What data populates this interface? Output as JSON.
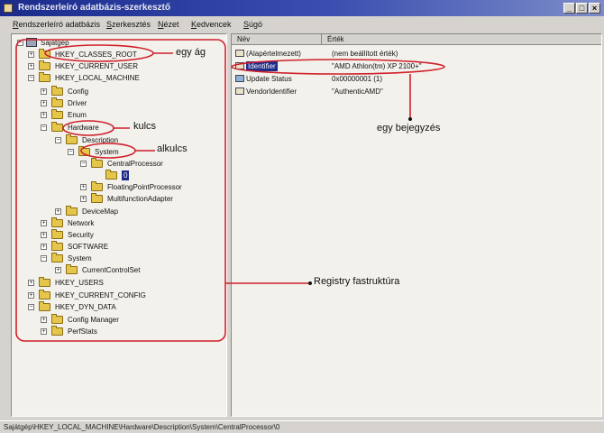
{
  "window": {
    "title": "Rendszerleíró adatbázis-szerkesztő",
    "controls": [
      "_",
      "□",
      "×"
    ]
  },
  "menu": {
    "items": [
      "Rendszerleíró adatbázis",
      "Szerkesztés",
      "Nézet",
      "Kedvencek",
      "Súgó"
    ]
  },
  "tree": {
    "root": "Sajátgép",
    "hkey_classes_root": "HKEY_CLASSES_ROOT",
    "hkey_current_user": "HKEY_CURRENT_USER",
    "hkey_local_machine": "HKEY_LOCAL_MACHINE",
    "config": "Config",
    "driver": "Driver",
    "enum": "Enum",
    "hardware": "Hardware",
    "description": "Description",
    "system_sub": "System",
    "central_processor": "CentralProcessor",
    "zero": "0",
    "floating_point": "FloatingPointProcessor",
    "multifunction": "MultifunctionAdapter",
    "devicemap": "DeviceMap",
    "network": "Network",
    "security": "Security",
    "software": "SOFTWARE",
    "system": "System",
    "current_control_set": "CurrentControlSet",
    "hkey_users": "HKEY_USERS",
    "hkey_current_config": "HKEY_CURRENT_CONFIG",
    "hkey_dyn_data": "HKEY_DYN_DATA",
    "config_manager": "Config Manager",
    "perf_stats": "PerfStats"
  },
  "values": {
    "col_name": "Név",
    "col_data": "Érték",
    "rows": [
      {
        "name": "(Alapértelmezett)",
        "data": "(nem beállított érték)"
      },
      {
        "name": "Identifier",
        "data": "\"AMD Athlon(tm) XP 2100+\""
      },
      {
        "name": "Update Status",
        "data": "0x00000001 (1)"
      },
      {
        "name": "VendorIdentifier",
        "data": "\"AuthenticAMD\""
      }
    ]
  },
  "annotations": {
    "egy_ag": "egy ág",
    "kulcs": "kulcs",
    "alkulcs": "alkulcs",
    "bejegyzes": "egy bejegyzés",
    "fastruktura": "Registry fastruktúra"
  },
  "status": {
    "path": "Sajátgép\\HKEY_LOCAL_MACHINE\\Hardware\\Description\\System\\CentralProcessor\\0"
  },
  "colors": {
    "title_bar": "#1a2b8c",
    "annotation_red": "#d0202a",
    "selection": "#1c2a8a"
  }
}
